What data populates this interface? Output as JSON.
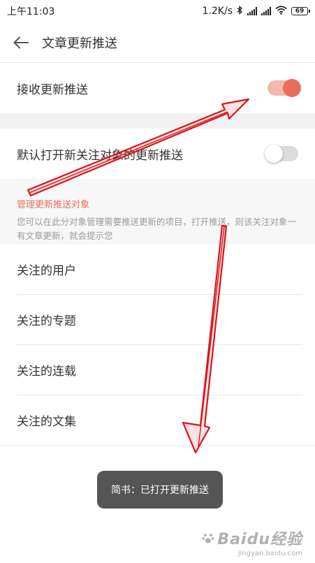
{
  "status_bar": {
    "time": "上午11:03",
    "network_speed": "1.2K/s",
    "battery": "69",
    "icons": [
      "bluetooth-icon",
      "signal-icon",
      "signal-icon",
      "wifi-icon",
      "battery-icon"
    ]
  },
  "header": {
    "back_icon": "arrow-left-icon",
    "title": "文章更新推送"
  },
  "settings": {
    "receive_push": {
      "label": "接收更新推送",
      "enabled": true
    },
    "default_follow_push": {
      "label": "默认打开新关注对象的更新推送",
      "enabled": false
    }
  },
  "manage_section": {
    "title": "管理更新推送对象",
    "description": "您可以在此分对象管理需要推送更新的项目，打开推送，则该关注对象一有文章更新，就会提示您"
  },
  "follow_list": [
    {
      "label": "关注的用户"
    },
    {
      "label": "关注的专题"
    },
    {
      "label": "关注的连载"
    },
    {
      "label": "关注的文集"
    }
  ],
  "toast": {
    "text": "简书：已打开更新推送"
  },
  "watermark": {
    "brand": "Baidu经验",
    "url": "jingyan.baidu.com"
  },
  "colors": {
    "accent": "#ea6f5a",
    "toggle_on_track": "#f3b8ae",
    "annotation_arrow": "#d9161c",
    "toast_bg": "#555555"
  }
}
